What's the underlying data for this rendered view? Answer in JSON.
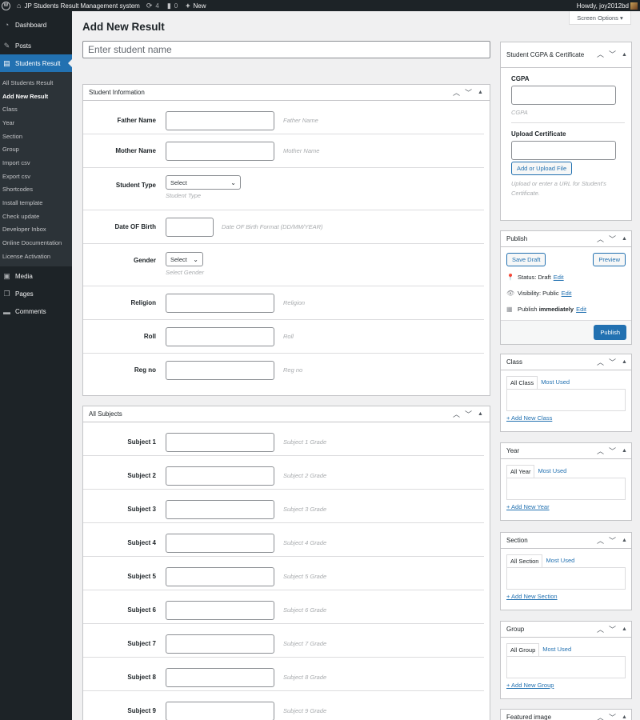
{
  "admin_bar": {
    "wp_logo": "wordpress-icon",
    "site_name": "JP Students Result Management system",
    "updates_count": "4",
    "comments_count": "0",
    "new_label": "New",
    "howdy": "Howdy, joy2012bd"
  },
  "sidebar": {
    "dashboard": "Dashboard",
    "posts": "Posts",
    "students_result": "Students Result",
    "submenu": [
      "All Students Result",
      "Add New Result",
      "Class",
      "Year",
      "Section",
      "Group",
      "Import csv",
      "Export csv",
      "Shortcodes",
      "Install template",
      "Check update",
      "Developer Inbox",
      "Online Documentation",
      "License Activation"
    ],
    "media": "Media",
    "pages": "Pages",
    "comments": "Comments"
  },
  "screen_options": "Screen Options ▾",
  "page_title": "Add New Result",
  "title_input": {
    "placeholder": "Enter student name",
    "value": ""
  },
  "student_info": {
    "title": "Student Information",
    "father": {
      "label": "Father Name",
      "desc": "Father Name"
    },
    "mother": {
      "label": "Mother Name",
      "desc": "Mother Name"
    },
    "student_type": {
      "label": "Student Type",
      "selected": "Select",
      "desc": "Student Type"
    },
    "dob": {
      "label": "Date OF Birth",
      "desc": "Date OF Birth Format (DD/MM/YEAR)"
    },
    "gender": {
      "label": "Gender",
      "selected": "Select",
      "desc": "Select Gender"
    },
    "religion": {
      "label": "Religion",
      "desc": "Religion"
    },
    "roll": {
      "label": "Roll",
      "desc": "Roll"
    },
    "regno": {
      "label": "Reg no",
      "desc": "Reg no"
    }
  },
  "subjects": {
    "title": "All Subjects",
    "rows": [
      {
        "label": "Subject 1",
        "desc": "Subject 1 Grade"
      },
      {
        "label": "Subject 2",
        "desc": "Subject 2 Grade"
      },
      {
        "label": "Subject 3",
        "desc": "Subject 3 Grade"
      },
      {
        "label": "Subject 4",
        "desc": "Subject 4 Grade"
      },
      {
        "label": "Subject 5",
        "desc": "Subject 5 Grade"
      },
      {
        "label": "Subject 6",
        "desc": "Subject 6 Grade"
      },
      {
        "label": "Subject 7",
        "desc": "Subject 7 Grade"
      },
      {
        "label": "Subject 8",
        "desc": "Subject 8 Grade"
      },
      {
        "label": "Subject 9",
        "desc": "Subject 9 Grade"
      }
    ]
  },
  "cgpa_box": {
    "title": "Student CGPA & Certificate",
    "cgpa_label": "CGPA",
    "cgpa_desc": "CGPA",
    "upload_label": "Upload Certificate",
    "upload_button": "Add or Upload File",
    "upload_desc": "Upload or enter a URL for Student's Certificate."
  },
  "publish_box": {
    "title": "Publish",
    "save_draft": "Save Draft",
    "preview": "Preview",
    "status_label": "Status:",
    "status_value": "Draft",
    "visibility_label": "Visibility:",
    "visibility_value": "Public",
    "publish_label": "Publish",
    "publish_value": "immediately",
    "edit": "Edit",
    "publish_button": "Publish"
  },
  "taxonomies": [
    {
      "title": "Class",
      "all": "All Class",
      "most_used": "Most Used",
      "add_new": "+ Add New Class"
    },
    {
      "title": "Year",
      "all": "All Year",
      "most_used": "Most Used",
      "add_new": "+ Add New Year"
    },
    {
      "title": "Section",
      "all": "All Section",
      "most_used": "Most Used",
      "add_new": "+ Add New Section"
    },
    {
      "title": "Group",
      "all": "All Group",
      "most_used": "Most Used",
      "add_new": "+ Add New Group"
    }
  ],
  "featured_image": {
    "title": "Featured image"
  },
  "colors": {
    "accent": "#2271b1",
    "sidebar_bg": "#1d2327",
    "submenu_bg": "#2c3338",
    "page_bg": "#f0f0f1"
  }
}
